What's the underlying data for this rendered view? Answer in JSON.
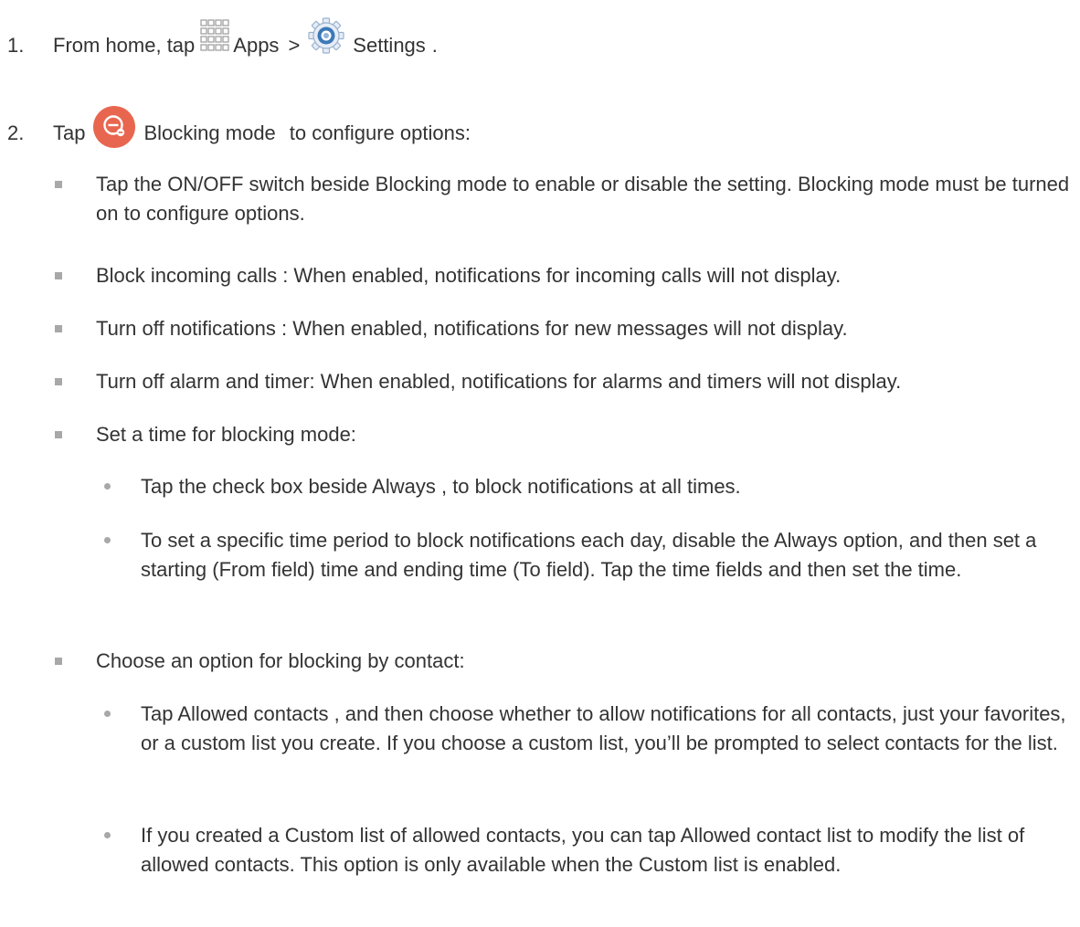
{
  "step1": {
    "number": "1.",
    "prefix": "From home, tap",
    "apps_icon": "apps-grid-icon",
    "apps_label": "Apps",
    "separator": ">",
    "settings_icon": "settings-gear-icon",
    "settings_label": "Settings",
    "end": "."
  },
  "step2": {
    "number": "2.",
    "prefix": "Tap",
    "blocking_icon": "blocking-mode-icon",
    "blocking_label": "Blocking mode",
    "suffix": "to configure options:"
  },
  "bullets": {
    "onoff": "Tap the ON/OFF switch beside Blocking mode   to enable or disable the setting. Blocking mode must be turned on to configure options.",
    "calls": "Block incoming calls   : When enabled, notifications for incoming calls will not display.",
    "notifications": "Turn off notifications   : When enabled, notifications for new messages will not display.",
    "alarm": "Turn off alarm and timer: When enabled, notifications for alarms and timers will not display.",
    "set_time": "Set a time for blocking mode:",
    "contact": "Choose an option for blocking by contact:"
  },
  "sub_time": {
    "always": "Tap the check box beside Always , to block notifications at all times.",
    "period": "To set a specific time period to block notifications each day, disable the Always option, and then set a starting (From field) time and ending time (To field). Tap the time fields and then set the time."
  },
  "sub_contact": {
    "allowed": "Tap Allowed contacts   , and then choose whether to allow notifications for all contacts, just your favorites, or a custom list you create. If you choose a custom list, you’ll be prompted to select contacts for the list.",
    "custom": "If you created a Custom list of allowed contacts, you can tap Allowed contact list   to modify the list of allowed contacts. This option is only available when the Custom list is enabled."
  },
  "colors": {
    "text": "#333333",
    "bullet": "#a8a8a8",
    "blocking_icon": "#e8664f",
    "settings_icon": "#3b78b8"
  }
}
